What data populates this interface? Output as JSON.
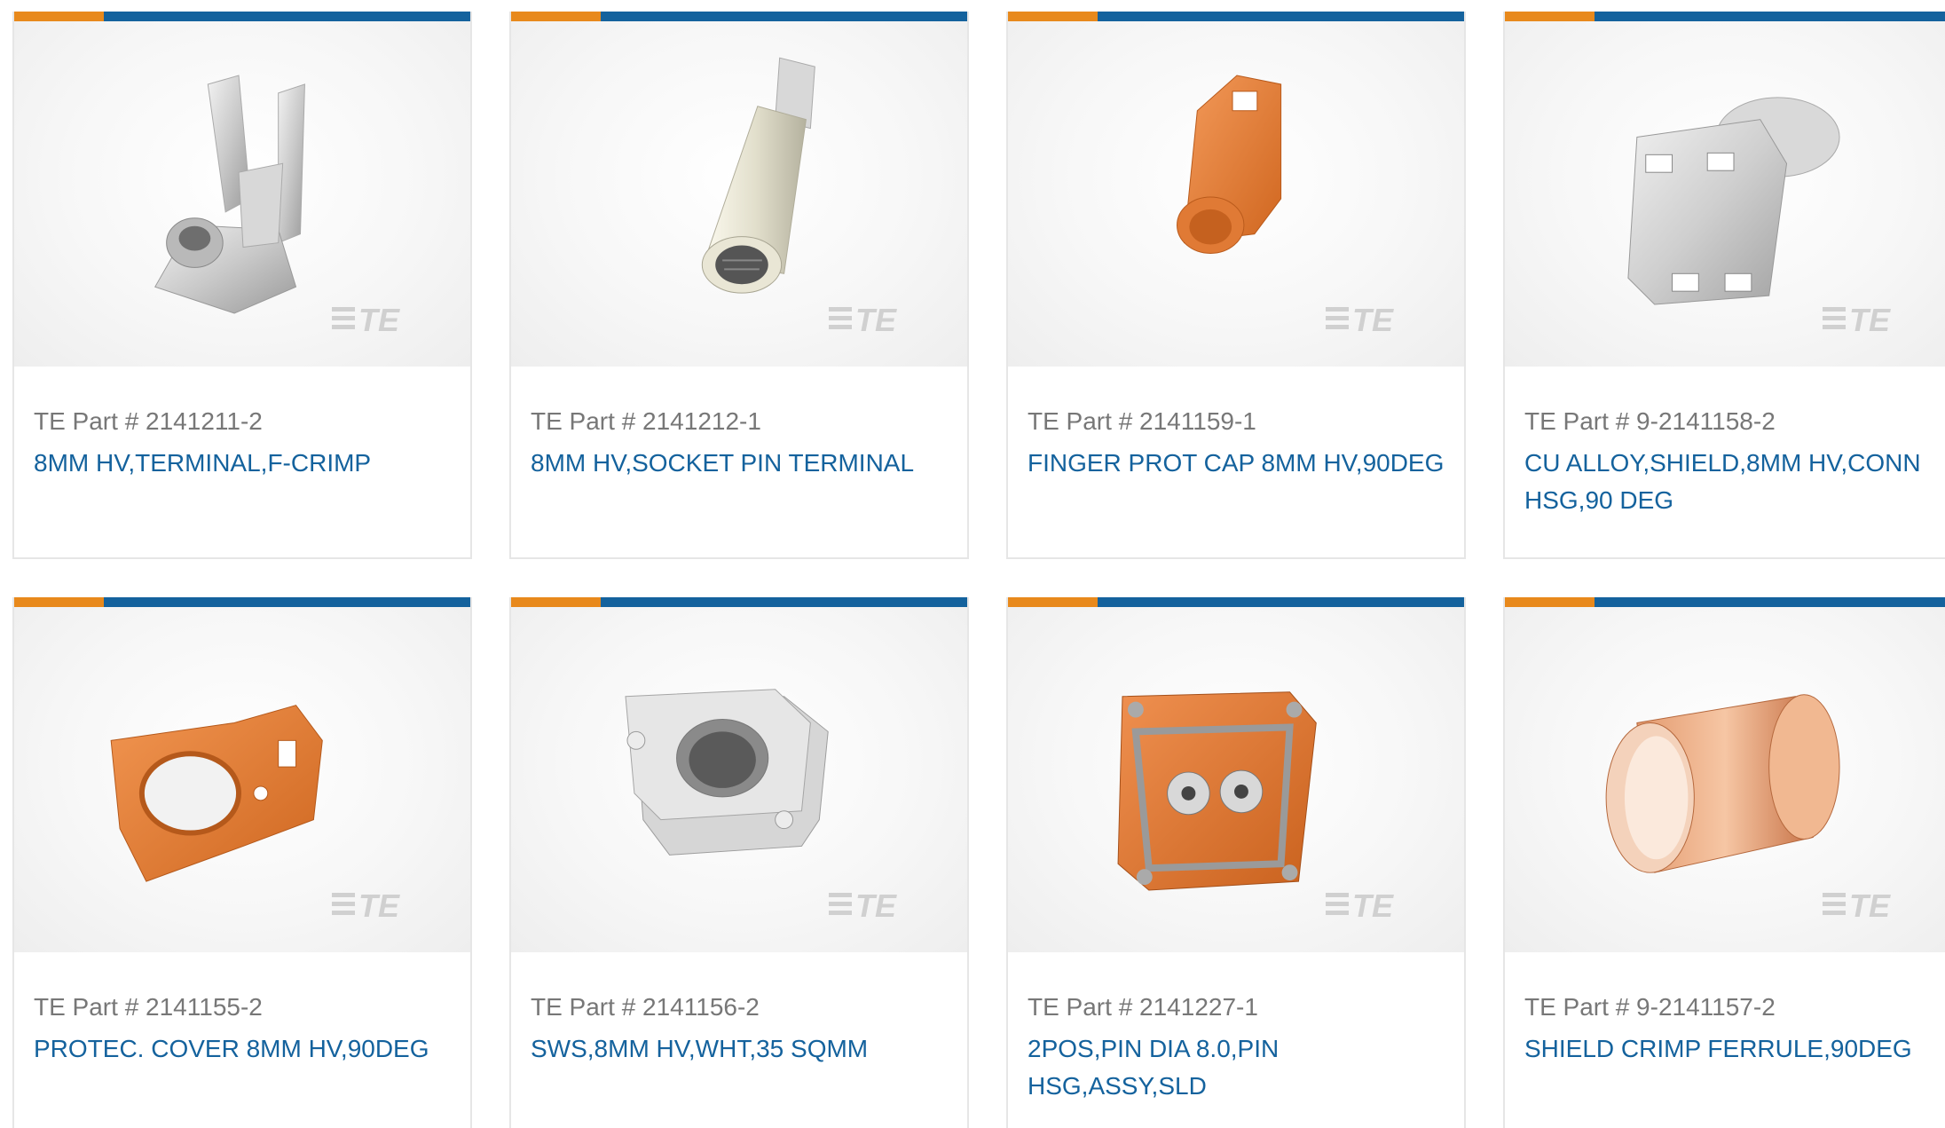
{
  "products": [
    {
      "part_label": "TE Part # 2141211-2",
      "description": "8MM HV,TERMINAL,F-CRIMP",
      "image_icon": "terminal-crimp-icon"
    },
    {
      "part_label": "TE Part # 2141212-1",
      "description": "8MM HV,SOCKET PIN TERMINAL",
      "image_icon": "socket-pin-icon"
    },
    {
      "part_label": "TE Part # 2141159-1",
      "description": "FINGER PROT CAP 8MM HV,90DEG",
      "image_icon": "finger-cap-icon"
    },
    {
      "part_label": "TE Part # 9-2141158-2",
      "description": "CU ALLOY,SHIELD,8MM HV,CONN HSG,90 DEG",
      "image_icon": "shield-housing-icon"
    },
    {
      "part_label": "TE Part # 2141155-2",
      "description": "PROTEC. COVER 8MM HV,90DEG",
      "image_icon": "protective-cover-icon"
    },
    {
      "part_label": "TE Part # 2141156-2",
      "description": "SWS,8MM HV,WHT,35 SQMM",
      "image_icon": "seal-icon"
    },
    {
      "part_label": "TE Part # 2141227-1",
      "description": "2POS,PIN DIA 8.0,PIN HSG,ASSY,SLD",
      "image_icon": "pin-housing-icon"
    },
    {
      "part_label": "TE Part # 9-2141157-2",
      "description": "SHIELD CRIMP FERRULE,90DEG",
      "image_icon": "ferrule-icon"
    }
  ],
  "brand": {
    "logo_text": "TE",
    "accent_orange": "#e8891c",
    "accent_blue": "#14629d"
  }
}
